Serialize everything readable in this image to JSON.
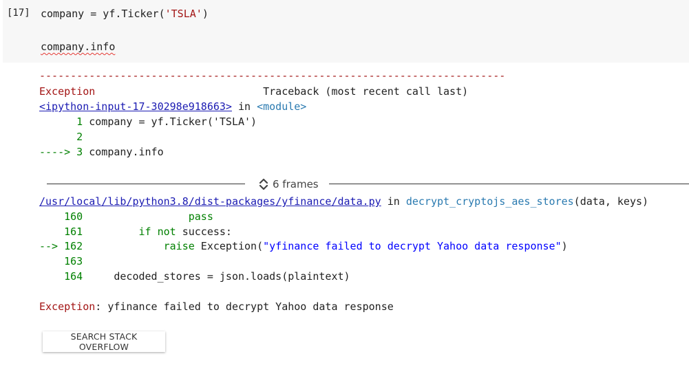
{
  "cell": {
    "execution_count": "[17]",
    "code_lines": [
      {
        "prefix": "company = yf.Ticker(",
        "string": "'TSLA'",
        "suffix": ")"
      },
      {
        "text": "company.info"
      }
    ]
  },
  "output": {
    "dashes": "---------------------------------------------------------------------------",
    "exception_name": "Exception",
    "traceback_header": "Traceback (most recent call last)",
    "input_link": "<ipython-input-17-30298e918663>",
    "in_word": " in ",
    "module": "<module>",
    "frame1_lines": [
      {
        "marker": "      1 ",
        "code": "company = yf.Ticker('TSLA')"
      },
      {
        "marker": "      2 ",
        "code": ""
      },
      {
        "marker": "----> 3 ",
        "code": "company.info"
      }
    ],
    "frames_label": "6 frames",
    "file_link": "/usr/local/lib/python3.8/dist-packages/yfinance/data.py",
    "func_name": "decrypt_cryptojs_aes_stores",
    "func_args": "(data, keys)",
    "frame2_lines": [
      {
        "marker": "    160 ",
        "code": "                pass",
        "style": "green"
      },
      {
        "marker": "    161 ",
        "code": "        if not success:",
        "style": "mixed_if"
      },
      {
        "marker": "--> 162 ",
        "code": "            raise Exception(\"yfinance failed to decrypt Yahoo data response\")",
        "style": "raise"
      },
      {
        "marker": "    163 ",
        "code": "",
        "style": "plain"
      },
      {
        "marker": "    164 ",
        "code": "    decoded_stores = json.loads(plaintext)",
        "style": "plain"
      }
    ],
    "final_exception_name": "Exception",
    "final_exception_message": ": yfinance failed to decrypt Yahoo data response"
  },
  "buttons": {
    "search_stack_overflow": "SEARCH STACK OVERFLOW"
  },
  "icons": {
    "frames_toggle": "unfold-chevrons-icon"
  }
}
